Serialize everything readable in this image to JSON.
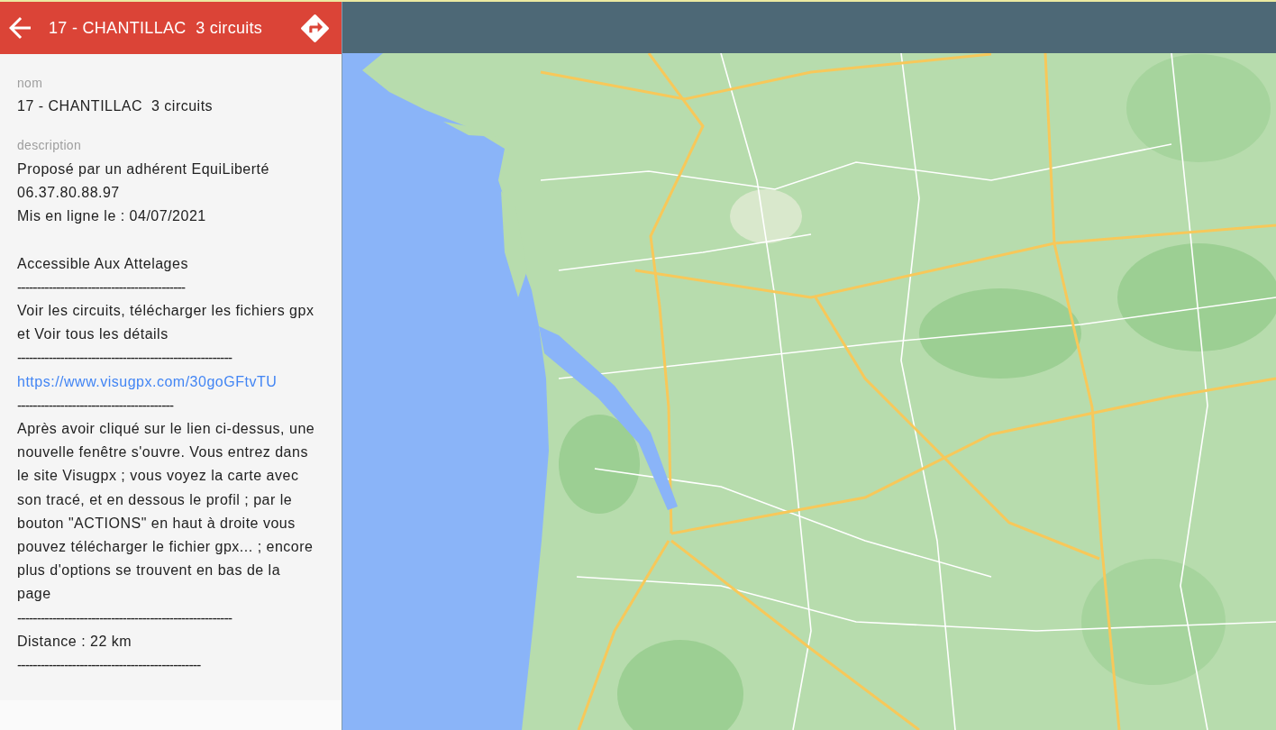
{
  "header": {
    "title": "17 - CHANTILLAC  3 circuits"
  },
  "name_field": {
    "label": "nom",
    "value": "17 - CHANTILLAC  3 circuits"
  },
  "description": {
    "label": "description",
    "blocks": [
      {
        "lines": [
          {
            "kind": "text",
            "text": "Proposé par un adhérent EquiLiberté"
          },
          {
            "kind": "text",
            "text": "06.37.80.88.97"
          },
          {
            "kind": "text",
            "text": "Mis en ligne le : 04/07/2021"
          }
        ]
      },
      {
        "lines": [
          {
            "kind": "text",
            "text": "Accessible Aux Attelages"
          },
          {
            "kind": "rule",
            "text": "-------------------------------------------"
          },
          {
            "kind": "text",
            "text": "Voir les circuits, télécharger les fichiers gpx et Voir tous les détails"
          },
          {
            "kind": "rule",
            "text": "-------------------------------------------------------"
          },
          {
            "kind": "link",
            "text": "https://www.visugpx.com/30goGFtvTU"
          },
          {
            "kind": "rule",
            "text": "----------------------------------------"
          },
          {
            "kind": "text",
            "text": "Après avoir cliqué sur le lien ci-dessus, une nouvelle fenêtre s'ouvre. Vous entrez dans le site Visugpx ; vous voyez la carte avec son tracé, et en dessous le profil ; par le bouton \"ACTIONS\" en haut à droite vous pouvez télécharger le fichier gpx... ; encore plus d'options se trouvent en bas de la page"
          },
          {
            "kind": "rule",
            "text": "-------------------------------------------------------"
          },
          {
            "kind": "text",
            "text": "Distance : 22 km"
          },
          {
            "kind": "rule",
            "text": "-----------------------------------------------"
          }
        ]
      }
    ]
  }
}
